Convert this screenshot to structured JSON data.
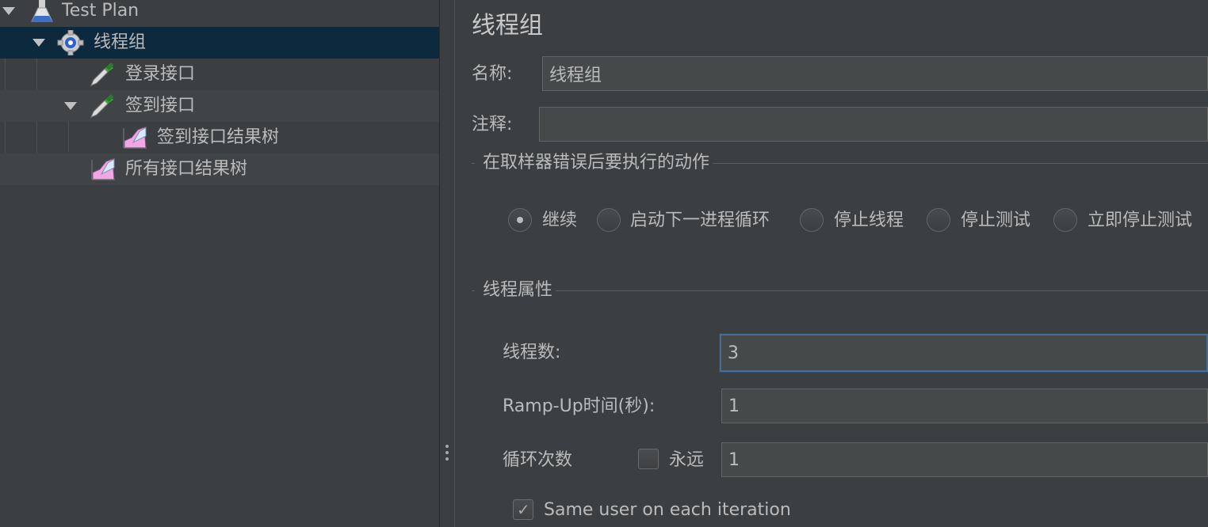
{
  "tree": {
    "items": [
      {
        "label": "Test Plan",
        "icon": "flask-icon"
      },
      {
        "label": "线程组",
        "icon": "gear-icon"
      },
      {
        "label": "登录接口",
        "icon": "pipette-icon"
      },
      {
        "label": "签到接口",
        "icon": "pipette-icon"
      },
      {
        "label": "签到接口结果树",
        "icon": "graph-icon"
      },
      {
        "label": "所有接口结果树",
        "icon": "graph-icon"
      }
    ]
  },
  "panel": {
    "title": "线程组",
    "name_label": "名称:",
    "name_value": "线程组",
    "comment_label": "注释:",
    "comment_value": "",
    "on_error": {
      "group_title": "在取样器错误后要执行的动作",
      "options": [
        "继续",
        "启动下一进程循环",
        "停止线程",
        "停止测试",
        "立即停止测试"
      ],
      "selected": "继续"
    },
    "thread_props": {
      "group_title": "线程属性",
      "threads_label": "线程数:",
      "threads_value": "3",
      "rampup_label": "Ramp-Up时间(秒):",
      "rampup_value": "1",
      "loop_label": "循环次数",
      "forever_label": "永远",
      "forever_checked": false,
      "loop_value": "1",
      "same_user_label": "Same user on each iteration",
      "same_user_checked": true
    }
  },
  "colors": {
    "background": "#3c3f41",
    "selection": "#0d293e",
    "field_bg": "#45494a",
    "focus_border": "#466d94"
  }
}
